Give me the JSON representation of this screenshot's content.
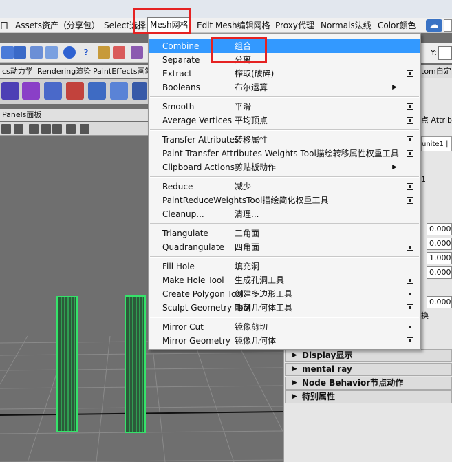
{
  "menubar": {
    "items": [
      {
        "label": "口"
      },
      {
        "label": "Assets资产（分享包）"
      },
      {
        "label": "Select选择"
      },
      {
        "label": "Mesh网格"
      },
      {
        "label": "Edit Mesh编辑网格"
      },
      {
        "label": "Proxy代理"
      },
      {
        "label": "Normals法线"
      },
      {
        "label": "Color颜色"
      }
    ],
    "open_menu": "Mesh网格"
  },
  "shelf_tabs": [
    "cs动力学",
    "Rendering渲染",
    "PaintEffects画笔"
  ],
  "panels_label": "Panels面板",
  "right_panel": {
    "y_label": "Y:",
    "partial_top": "tom自定义",
    "partial_tabs": "点 Attrib",
    "partial_tab2": "unite1 | po",
    "values": [
      "1",
      "0.000",
      "0.000",
      "1.000",
      "0.000",
      "0.000"
    ],
    "small_char": "换",
    "sections": [
      "Display显示",
      "mental ray",
      "Node Behavior节点动作",
      "特别属性"
    ]
  },
  "mesh_menu": {
    "groups": [
      [
        {
          "en": "Combine",
          "zh": "组合",
          "option": false,
          "submenu": false,
          "highlighted": true
        },
        {
          "en": "Separate",
          "zh": "分离",
          "option": false,
          "submenu": false
        },
        {
          "en": "Extract",
          "zh": "榨取(破碎)",
          "option": true,
          "submenu": false
        },
        {
          "en": "Booleans",
          "zh": "布尔运算",
          "option": false,
          "submenu": true
        }
      ],
      [
        {
          "en": "Smooth",
          "zh": "平滑",
          "option": true,
          "submenu": false
        },
        {
          "en": "Average Vertices",
          "zh": "平均顶点",
          "option": true,
          "submenu": false
        }
      ],
      [
        {
          "en": "Transfer Attributes",
          "zh": "转移属性",
          "option": true,
          "submenu": false
        },
        {
          "en": "Paint Transfer Attributes Weights Tool描绘转移属性权重工具",
          "zh": "",
          "option": true,
          "submenu": false
        },
        {
          "en": "Clipboard Actions",
          "zh": "剪贴板动作",
          "option": false,
          "submenu": true
        }
      ],
      [
        {
          "en": "Reduce",
          "zh": "减少",
          "option": true,
          "submenu": false
        },
        {
          "en": "PaintReduceWeightsTool描绘简化权重工具",
          "zh": "",
          "option": true,
          "submenu": false
        },
        {
          "en": "Cleanup...",
          "zh": "清理...",
          "option": false,
          "submenu": false
        }
      ],
      [
        {
          "en": "Triangulate",
          "zh": "三角面",
          "option": false,
          "submenu": false
        },
        {
          "en": "Quadrangulate",
          "zh": "四角面",
          "option": true,
          "submenu": false
        }
      ],
      [
        {
          "en": "Fill Hole",
          "zh": "填充洞",
          "option": false,
          "submenu": false
        },
        {
          "en": "Make Hole Tool",
          "zh": "生成孔洞工具",
          "option": true,
          "submenu": false
        },
        {
          "en": "Create Polygon Tool",
          "zh": "创建多边形工具",
          "option": true,
          "submenu": false
        },
        {
          "en": "Sculpt Geometry Tool",
          "zh": "雕刻几何体工具",
          "option": true,
          "submenu": false
        }
      ],
      [
        {
          "en": "Mirror Cut",
          "zh": "镜像剪切",
          "option": true,
          "submenu": false
        },
        {
          "en": "Mirror Geometry",
          "zh": "镜像几何体",
          "option": true,
          "submenu": false
        }
      ]
    ]
  },
  "colors": {
    "highlight": "#3399ff",
    "annotation": "#e52222",
    "wireframe": "#35e36a"
  }
}
